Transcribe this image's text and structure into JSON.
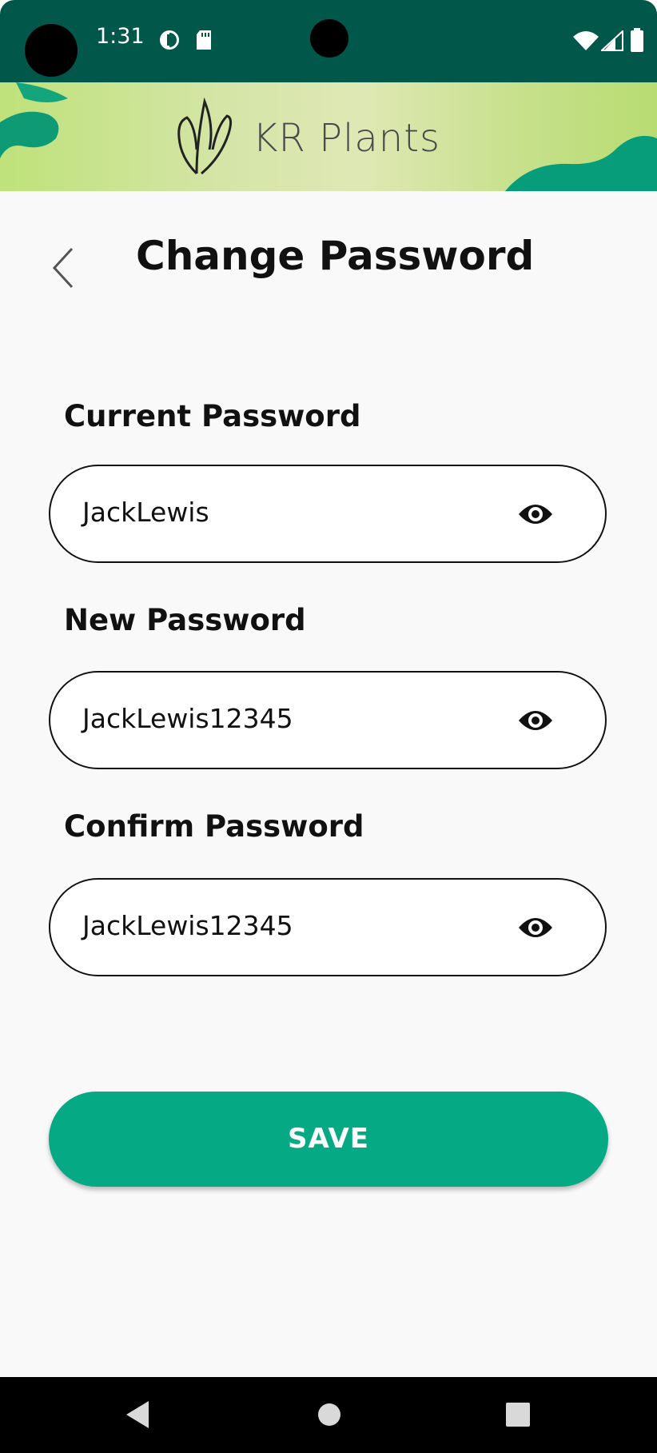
{
  "status_bar": {
    "time": "1:31",
    "icons": [
      "data-saver-icon",
      "sd-card-icon",
      "wifi-icon",
      "signal-icon",
      "battery-icon"
    ]
  },
  "banner": {
    "brand_name": "KR Plants"
  },
  "header": {
    "title": "Change Password",
    "back_icon": "chevron-left-icon"
  },
  "form": {
    "fields": [
      {
        "label": "Current Password",
        "value": "JackLewis",
        "icon": "eye-icon"
      },
      {
        "label": "New Password",
        "value": "JackLewis12345",
        "icon": "eye-icon"
      },
      {
        "label": "Confirm Password",
        "value": "JackLewis12345",
        "icon": "eye-icon"
      }
    ],
    "save_label": "SAVE"
  },
  "nav_bar": {
    "buttons": [
      "back-triangle-icon",
      "home-circle-icon",
      "recents-square-icon"
    ]
  },
  "colors": {
    "status_bar": "#02574b",
    "accent": "#05a984",
    "background": "#f9f9f9",
    "text": "#111111"
  }
}
